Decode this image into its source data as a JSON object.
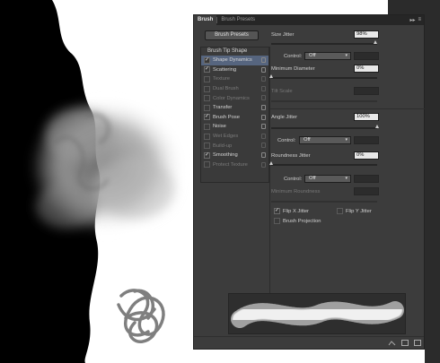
{
  "panel": {
    "tabs": [
      {
        "label": "Brush"
      },
      {
        "label": "Brush Presets"
      }
    ],
    "tab_controls": {
      "collapse": "▸▸",
      "menu": "≡"
    },
    "presets_button": "Brush Presets",
    "brush_tip_shape": "Brush Tip Shape",
    "options": [
      {
        "label": "Shape Dynamics",
        "checked": true,
        "enabled": true,
        "selected": true
      },
      {
        "label": "Scattering",
        "checked": true,
        "enabled": true
      },
      {
        "label": "Texture",
        "checked": false,
        "enabled": false
      },
      {
        "label": "Dual Brush",
        "checked": false,
        "enabled": false
      },
      {
        "label": "Color Dynamics",
        "checked": false,
        "enabled": false
      },
      {
        "label": "Transfer",
        "checked": false,
        "enabled": true
      },
      {
        "label": "Brush Pose",
        "checked": true,
        "enabled": true
      },
      {
        "label": "Noise",
        "checked": false,
        "enabled": true
      },
      {
        "label": "Wet Edges",
        "checked": false,
        "enabled": false
      },
      {
        "label": "Build-up",
        "checked": false,
        "enabled": false
      },
      {
        "label": "Smoothing",
        "checked": true,
        "enabled": true
      },
      {
        "label": "Protect Texture",
        "checked": false,
        "enabled": false
      }
    ],
    "size_jitter": {
      "label": "Size Jitter",
      "value": "98%"
    },
    "control1": {
      "label": "Control:",
      "value": "Off"
    },
    "min_diameter": {
      "label": "Minimum Diameter",
      "value": "0%"
    },
    "tilt_scale": {
      "label": "Tilt Scale"
    },
    "angle_jitter": {
      "label": "Angle Jitter",
      "value": "100%"
    },
    "control2": {
      "label": "Control:",
      "value": "Off"
    },
    "roundness_jitter": {
      "label": "Roundness Jitter",
      "value": "0%"
    },
    "control3": {
      "label": "Control:",
      "value": "Off"
    },
    "min_roundness": {
      "label": "Minimum Roundness"
    },
    "flip_x": {
      "label": "Flip X Jitter",
      "checked": true
    },
    "flip_y": {
      "label": "Flip Y Jitter",
      "checked": false
    },
    "projection": {
      "label": "Brush Projection",
      "checked": false
    },
    "checkmark": "✓"
  },
  "colors": {
    "accent_selection": "#56657f",
    "panel_bg": "#3c3c3c"
  }
}
